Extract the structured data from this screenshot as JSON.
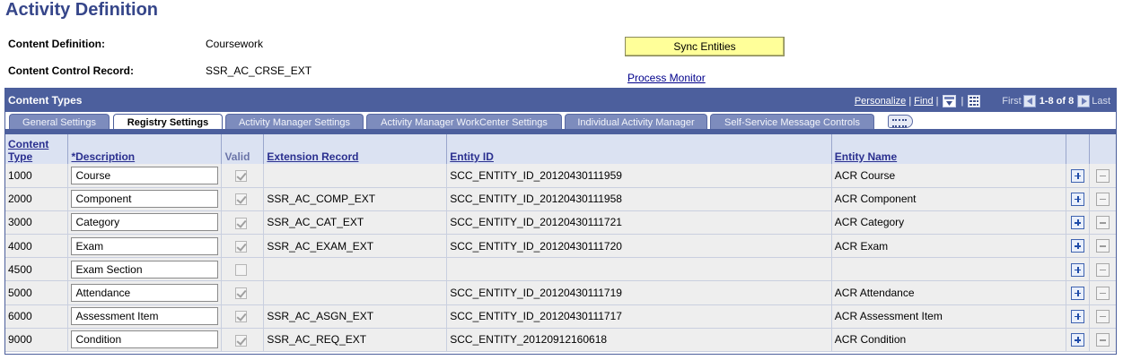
{
  "page": {
    "title": "Activity Definition"
  },
  "header_fields": {
    "content_definition_label": "Content Definition:",
    "content_definition_value": "Coursework",
    "content_control_record_label": "Content Control Record:",
    "content_control_record_value": "SSR_AC_CRSE_EXT",
    "sync_entities_label": "Sync Entities",
    "process_monitor_label": "Process Monitor"
  },
  "grid": {
    "title": "Content Types",
    "nav": {
      "personalize": "Personalize",
      "separator": "|",
      "find": "Find",
      "first": "First",
      "range": "1-8 of 8",
      "last": "Last"
    },
    "tabs": [
      {
        "label": "General Settings",
        "active": false
      },
      {
        "label": "Registry Settings",
        "active": true
      },
      {
        "label": "Activity Manager Settings",
        "active": false
      },
      {
        "label": "Activity Manager WorkCenter Settings",
        "active": false
      },
      {
        "label": "Individual Activity Manager",
        "active": false
      },
      {
        "label": "Self-Service Message Controls",
        "active": false
      }
    ],
    "columns": {
      "content_type_1": "Content",
      "content_type_2": "Type",
      "description": "*Description",
      "valid": "Valid",
      "extension_record": "Extension Record",
      "entity_id": "Entity ID",
      "entity_name": "Entity Name"
    },
    "rows": [
      {
        "type": "1000",
        "description": "Course",
        "valid": true,
        "extension_record": "",
        "entity_id": "SCC_ENTITY_ID_20120430111959",
        "entity_name": "ACR Course"
      },
      {
        "type": "2000",
        "description": "Component",
        "valid": true,
        "extension_record": "SSR_AC_COMP_EXT",
        "entity_id": "SCC_ENTITY_ID_20120430111958",
        "entity_name": "ACR Component"
      },
      {
        "type": "3000",
        "description": "Category",
        "valid": true,
        "extension_record": "SSR_AC_CAT_EXT",
        "entity_id": "SCC_ENTITY_ID_20120430111721",
        "entity_name": "ACR Category"
      },
      {
        "type": "4000",
        "description": "Exam",
        "valid": true,
        "extension_record": "SSR_AC_EXAM_EXT",
        "entity_id": "SCC_ENTITY_ID_20120430111720",
        "entity_name": "ACR Exam"
      },
      {
        "type": "4500",
        "description": "Exam Section",
        "valid": false,
        "extension_record": "",
        "entity_id": "",
        "entity_name": ""
      },
      {
        "type": "5000",
        "description": "Attendance",
        "valid": true,
        "extension_record": "",
        "entity_id": "SCC_ENTITY_ID_20120430111719",
        "entity_name": "ACR Attendance"
      },
      {
        "type": "6000",
        "description": "Assessment Item",
        "valid": true,
        "extension_record": "SSR_AC_ASGN_EXT",
        "entity_id": "SCC_ENTITY_ID_20120430111717",
        "entity_name": "ACR Assessment Item"
      },
      {
        "type": "9000",
        "description": "Condition",
        "valid": true,
        "extension_record": "SSR_AC_REQ_EXT",
        "entity_id": "SCC_ENTITY_20120912160618",
        "entity_name": "ACR Condition"
      }
    ]
  },
  "colors": {
    "title": "#36468a",
    "grid_header": "#4c5f9d",
    "button_yellow": "#ffff99",
    "link": "#00008b"
  },
  "icons": {
    "download": "download-icon",
    "view_all": "grid-view-icon",
    "first": "arrow-left-icon",
    "last": "arrow-right-icon",
    "expand_tabs": "expand-tabs-icon",
    "add_row": "plus-icon",
    "delete_row": "minus-icon"
  }
}
